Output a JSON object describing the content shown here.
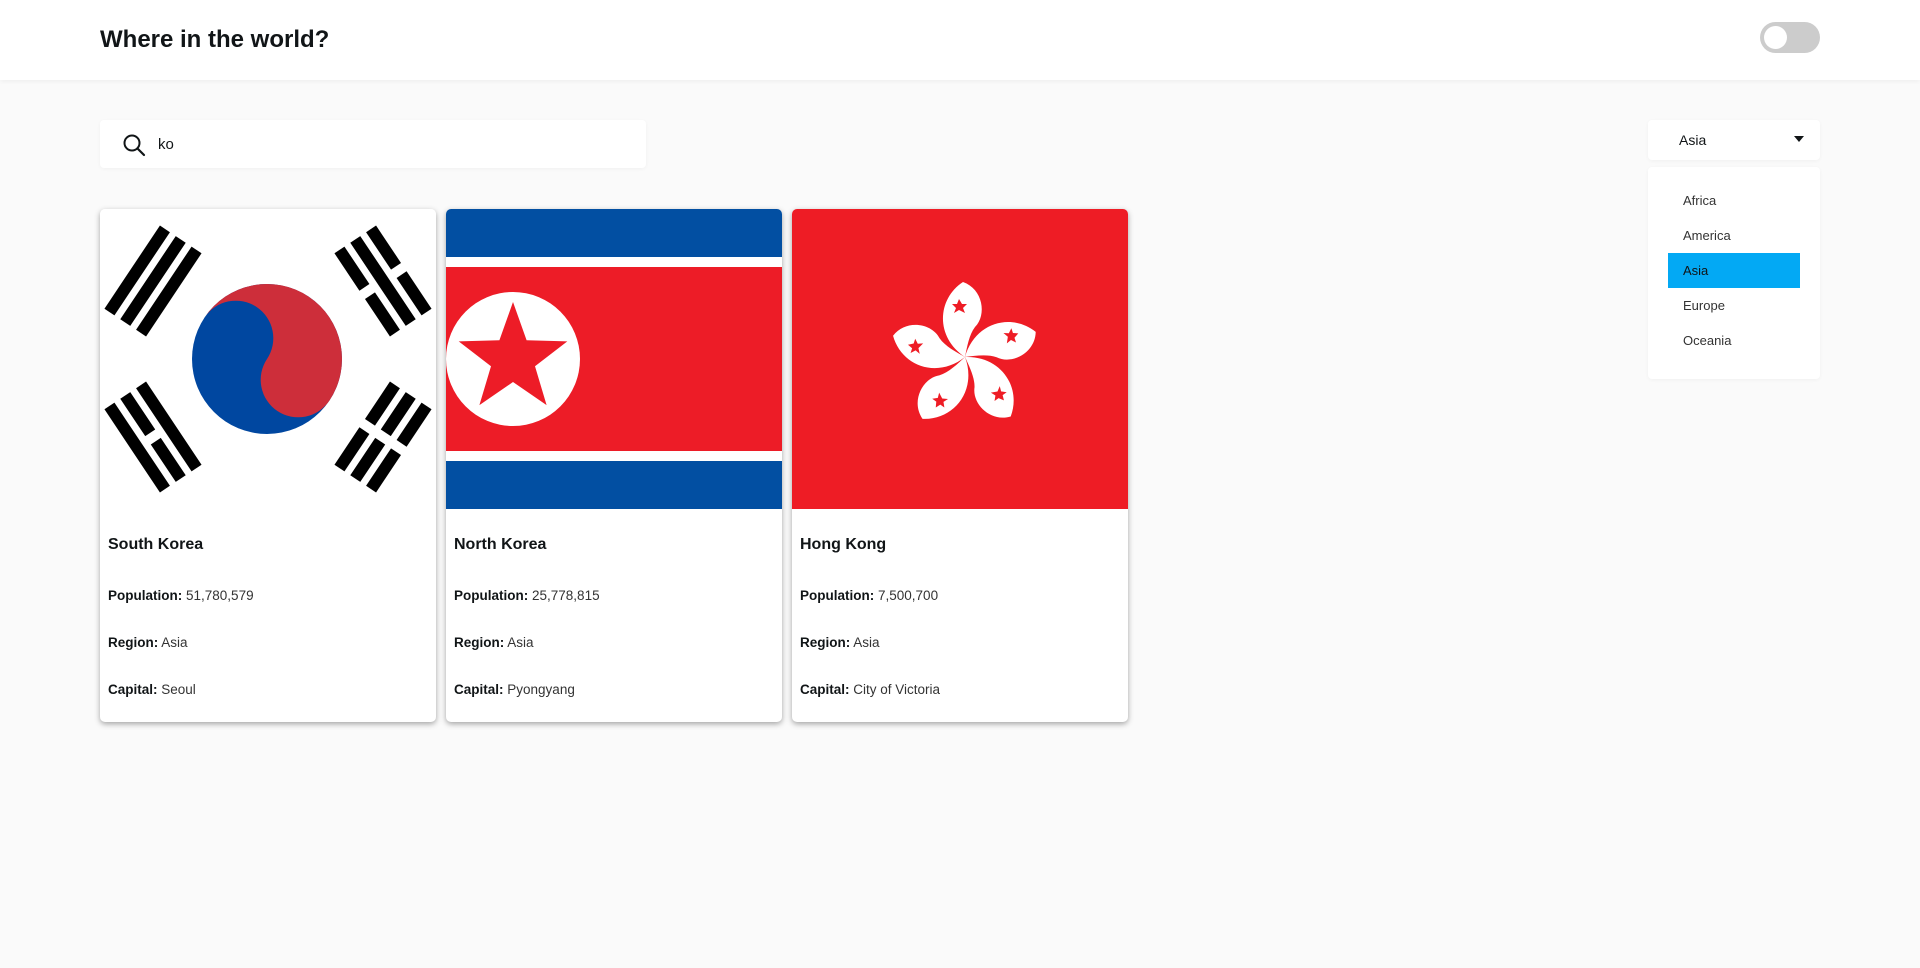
{
  "header": {
    "title": "Where in the world?"
  },
  "search": {
    "value": "ko",
    "placeholder": ""
  },
  "filter": {
    "selected": "Asia",
    "options": [
      "Africa",
      "America",
      "Asia",
      "Europe",
      "Oceania"
    ]
  },
  "labels": {
    "population": "Population:",
    "region": "Region:",
    "capital": "Capital:"
  },
  "countries": [
    {
      "name": "South Korea",
      "population": "51,780,579",
      "region": "Asia",
      "capital": "Seoul",
      "flag": "south-korea-flag"
    },
    {
      "name": "North Korea",
      "population": "25,778,815",
      "region": "Asia",
      "capital": "Pyongyang",
      "flag": "north-korea-flag"
    },
    {
      "name": "Hong Kong",
      "population": "7,500,700",
      "region": "Asia",
      "capital": "City of Victoria",
      "flag": "hong-kong-flag"
    }
  ],
  "colors": {
    "accent": "#03a9f4",
    "background": "#fafafa",
    "toggle_off": "#cccccc"
  }
}
